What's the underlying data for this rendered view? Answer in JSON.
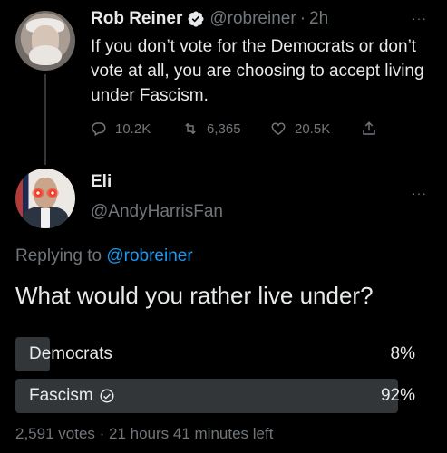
{
  "tweet": {
    "name": "Rob Reiner",
    "handle": "@robreiner",
    "separator": "·",
    "time": "2h",
    "text": "If you don’t vote for the Democrats or don’t vote at all, you are choosing to accept living under Fascism.",
    "more": "···",
    "replies": "10.2K",
    "retweets": "6,365",
    "likes": "20.5K"
  },
  "reply": {
    "name": "Eli",
    "handle": "@AndyHarrisFan",
    "more": "···",
    "replying_prefix": "Replying to ",
    "replying_to": "@robreiner",
    "question": "What would you rather live under?",
    "poll": {
      "options": [
        {
          "label": "Democrats",
          "percent": "8%",
          "fraction": 0.08
        },
        {
          "label": "Fascism",
          "percent": "92%",
          "fraction": 0.92
        }
      ],
      "meta": "2,591 votes · 21 hours 41 minutes left"
    }
  },
  "colors": {
    "background": "#000000",
    "text": "#e7e9ea",
    "muted": "#71767b",
    "link": "#1d9bf0",
    "poll_fill": "#333639"
  }
}
